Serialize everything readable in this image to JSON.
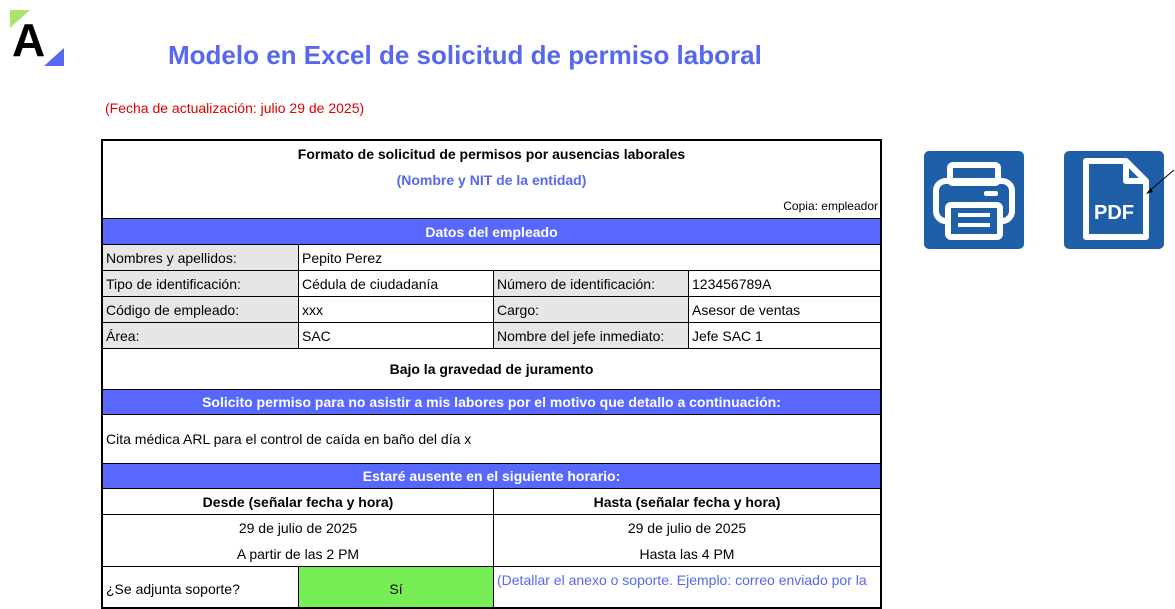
{
  "header": {
    "logo_letter": "A",
    "title": "Modelo en Excel de solicitud de permiso laboral",
    "update_note": "(Fecha de actualización: julio 29 de 2025)"
  },
  "form": {
    "heading": "Formato de solicitud de permisos por ausencias laborales",
    "entity_placeholder": "(Nombre y NIT de la entidad)",
    "copy_note": "Copia: empleador",
    "employee_section": "Datos del empleado",
    "fields": {
      "name_label": "Nombres y apellidos:",
      "name_value": "Pepito Perez",
      "id_type_label": "Tipo de identificación:",
      "id_type_value": "Cédula de ciudadanía",
      "id_number_label": "Número de identificación:",
      "id_number_value": "123456789A",
      "code_label": "Código de empleado:",
      "code_value": "xxx",
      "role_label": "Cargo:",
      "role_value": "Asesor de ventas",
      "area_label": "Área:",
      "area_value": "SAC",
      "boss_label": "Nombre del jefe inmediato:",
      "boss_value": "Jefe SAC 1"
    },
    "oath": "Bajo la gravedad de juramento",
    "reason_section": "Solicito permiso para no asistir a mis labores por el motivo que detallo a continuación:",
    "reason_text": "Cita médica ARL para el control de caída en baño del día x",
    "schedule_section": "Estaré ausente en el siguiente horario:",
    "from_header": "Desde (señalar fecha y hora)",
    "to_header": "Hasta (señalar fecha y hora)",
    "from_date": "29 de julio de 2025",
    "from_time": "A partir de las 2 PM",
    "to_date": "29 de julio de 2025",
    "to_time": "Hasta las 4 PM",
    "support_label": "¿Se adjunta soporte?",
    "support_value": "Sí",
    "support_detail": "(Detallar el anexo o soporte. Ejemplo: correo enviado por la"
  },
  "buttons": {
    "print_icon": "printer-icon",
    "pdf_icon": "pdf-file-icon",
    "pdf_text": "PDF"
  },
  "colors": {
    "title": "#5568ee",
    "band": "#5868ff",
    "update_note": "#e00000",
    "support_yes": "#77ee55",
    "button_bg": "#1f5fa8"
  }
}
